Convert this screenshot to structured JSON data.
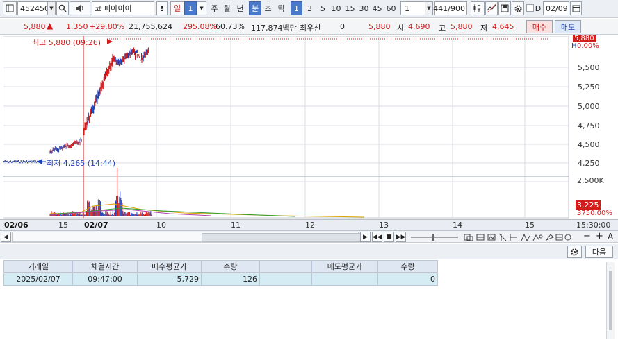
{
  "toolbar": {
    "stock_code": "452450",
    "market_badge": "코",
    "stock_name": "피아이이",
    "alert_mark": "!",
    "period_labels": [
      "일",
      "1",
      "주",
      "월",
      "년",
      "분",
      "초",
      "틱"
    ],
    "interval_labels": [
      "1",
      "3",
      "5",
      "10",
      "15",
      "30",
      "45",
      "60"
    ],
    "custom_interval": "1",
    "count_current": "441",
    "count_total": "/900",
    "checkbox_label": "D",
    "date": "02/09",
    "icons": [
      "layout-icon",
      "search-icon",
      "speaker-icon",
      "candle-icon",
      "chart-type-icon",
      "save-icon",
      "gear-icon",
      "calendar-icon"
    ]
  },
  "quote": {
    "price": "5,880",
    "change": "1,350",
    "change_rate": "+29.80%",
    "volume": "21,755,624",
    "volume_ratio": "295.08%",
    "turnover": "60.73%",
    "amount": "117,874백만",
    "priority_label": "최우선",
    "priority_value": "0",
    "best_price": "5,880",
    "open_label": "시",
    "open_value": "4,690",
    "high_label": "고",
    "high_value": "5,880",
    "low_label": "저",
    "low_value": "4,645",
    "buy_label": "매수",
    "sell_label": "매도"
  },
  "chart": {
    "high_annotation": "최고 5,880 (09:26)",
    "low_annotation": "최저 4,265 (14:44)",
    "price_axis": [
      "5,500",
      "5,250",
      "5,000",
      "4,750",
      "4,500",
      "4,250"
    ],
    "volume_axis": "2,500K",
    "current_price_box": "5,880",
    "rate_tag": "0.00%",
    "h_marker": "H",
    "volume_box": "3,225",
    "volume_rate_tag": "3750.00%",
    "buy_marker": "B",
    "colors": {
      "up": "#d21b1b",
      "down": "#1b3fb5",
      "grid": "#d9dee6"
    }
  },
  "date_axis": {
    "labels": [
      "02/06",
      "15",
      "02/07",
      "10",
      "11",
      "12",
      "13",
      "14",
      "15",
      "15:30:00"
    ]
  },
  "scroll_tools": {
    "zoom_out": "−",
    "zoom_in": "+",
    "text_tool": "A"
  },
  "lower": {
    "next_label": "다음",
    "headers": [
      "거래일",
      "체결시간",
      "매수평균가",
      "수량",
      "",
      "매도평균가",
      "수량"
    ],
    "rows": [
      [
        "2025/02/07",
        "09:47:00",
        "5,729",
        "126",
        "",
        "",
        "0"
      ]
    ]
  }
}
